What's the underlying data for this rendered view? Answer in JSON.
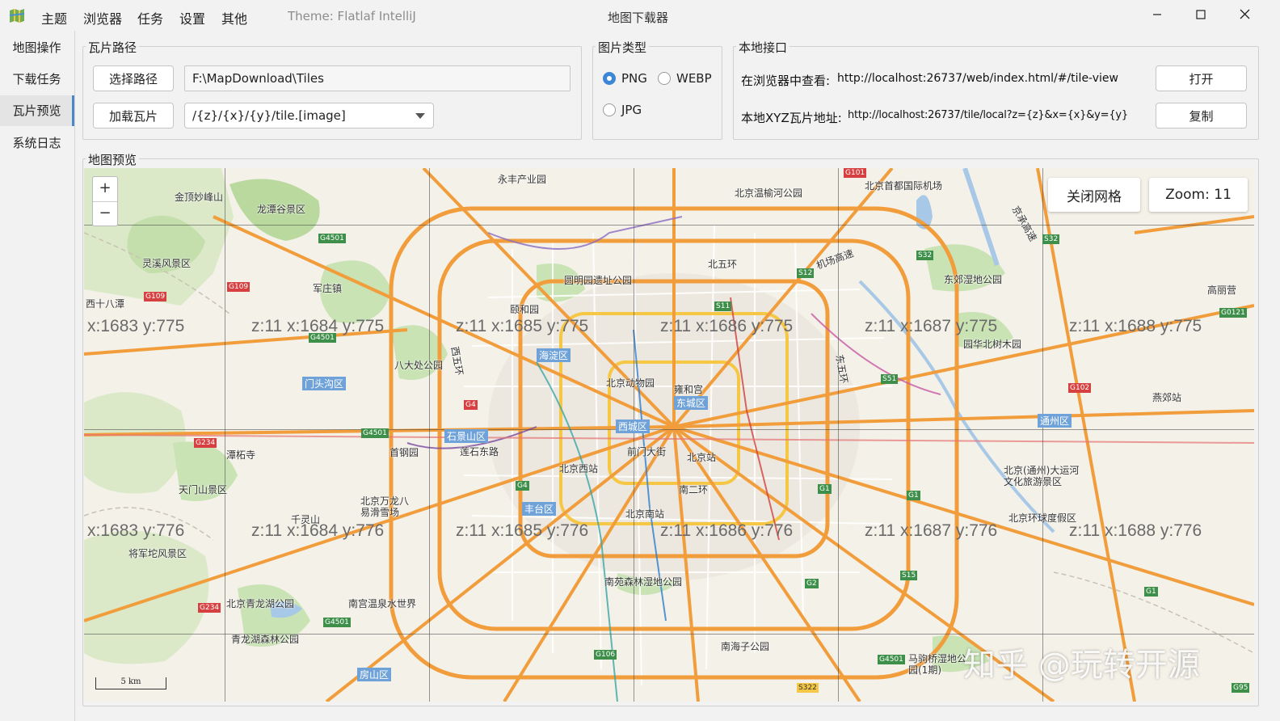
{
  "titlebar": {
    "menu": [
      "主题",
      "浏览器",
      "任务",
      "设置",
      "其他"
    ],
    "theme_label": "Theme: Flatlaf IntelliJ",
    "window_title": "地图下载器"
  },
  "sidebar": {
    "items": [
      "地图操作",
      "下载任务",
      "瓦片预览",
      "系统日志"
    ],
    "active": "瓦片预览"
  },
  "tile_path": {
    "group_title": "瓦片路径",
    "select_button": "选择路径",
    "path_value": "F:\\MapDownload\\Tiles",
    "load_button": "加载瓦片",
    "pattern_value": "/{z}/{x}/{y}/tile.[image]"
  },
  "image_type": {
    "group_title": "图片类型",
    "options": [
      "PNG",
      "WEBP",
      "JPG"
    ],
    "selected": "PNG"
  },
  "local_api": {
    "group_title": "本地接口",
    "browser_label": "在浏览器中查看:",
    "browser_url": "http://localhost:26737/web/index.html/#/tile-view",
    "open_button": "打开",
    "xyz_label": "本地XYZ瓦片地址:",
    "xyz_url": "http://localhost:26737/tile/local?z={z}&x={x}&y={y}",
    "copy_button": "复制"
  },
  "map_preview": {
    "group_title": "地图预览",
    "zoom_in": "+",
    "zoom_out": "−",
    "toggle_grid_button": "关闭网格",
    "zoom_label": "Zoom: 11",
    "scale_label": "5 km",
    "watermark": "知乎 @玩转开源",
    "tile_labels_row1": [
      "x:1683 y:775",
      "z:11 x:1684 y:775",
      "z:11 x:1685 y:775",
      "z:11 x:1686 y:775",
      "z:11 x:1687 y:775",
      "z:11 x:1688 y:775"
    ],
    "tile_labels_row2": [
      "x:1683 y:776",
      "z:11 x:1684 y:776",
      "z:11 x:1685 y:776",
      "z:11 x:1686 y:776",
      "z:11 x:1687 y:776",
      "z:11 x:1688 y:776"
    ],
    "places": {
      "p1": "金顶妙峰山",
      "p2": "龙潭谷景区",
      "p3": "永丰产业园",
      "p4": "北京温榆河公园",
      "p5": "北京首都国际机场",
      "p6": "灵溪风景区",
      "p7": "西十八潭",
      "p8": "军庄镇",
      "p9": "圆明园遗址公园",
      "p10": "颐和园",
      "p11": "东郊湿地公园",
      "p12": "北京动物园",
      "p13": "雍和宫",
      "p14": "八大处公园",
      "p15": "园华北树木园",
      "p16": "潭柘寺",
      "p17": "首钢园",
      "p18": "莲石东路",
      "p19": "前门大街",
      "p20": "北京站",
      "p21": "北京西站",
      "p22": "天门山景区",
      "p23": "北京万龙八易滑雪场",
      "p24": "千灵山",
      "p25": "北京南站",
      "p26": "北京(通州)大运河文化旅游景区",
      "p27": "北京环球度假区",
      "p28": "将军坨风景区",
      "p29": "南苑森林湿地公园",
      "p30": "北京青龙湖公园",
      "p31": "南宫温泉水世界",
      "p32": "青龙湖森林公园",
      "p33": "南海子公园",
      "p34": "马驹桥湿地公园(1期)",
      "p35": "燕郊站",
      "p36": "机场高速",
      "p37": "北五环",
      "p38": "南二环",
      "p39": "高丽营",
      "p40": "京承高速",
      "p41": "东五环",
      "p42": "西五环"
    },
    "districts": {
      "d1": "门头沟区",
      "d2": "海淀区",
      "d3": "东城区",
      "d4": "西城区",
      "d5": "石景山区",
      "d6": "丰台区",
      "d7": "通州区",
      "d8": "房山区"
    },
    "shields": {
      "s1": "G4501",
      "s2": "G109",
      "s3": "G109",
      "s4": "G4501",
      "s5": "G234",
      "s6": "G4501",
      "s7": "G101",
      "s8": "S32",
      "s9": "S32",
      "s10": "S12",
      "s11": "S11",
      "s12": "G0121",
      "s13": "S51",
      "s14": "G102",
      "s15": "G4",
      "s16": "G1",
      "s17": "G1",
      "s18": "G4",
      "s19": "S15",
      "s20": "G2",
      "s21": "G234",
      "s22": "G4501",
      "s23": "G106",
      "s24": "G4501",
      "s25": "S322",
      "s26": "G1",
      "s27": "G95"
    },
    "colors": {
      "motorway": "#f29d3c",
      "primary": "#f6c744",
      "water": "#a7c8e6",
      "park": "#c9e3b5",
      "district_bg": "#6ea2d8"
    }
  }
}
